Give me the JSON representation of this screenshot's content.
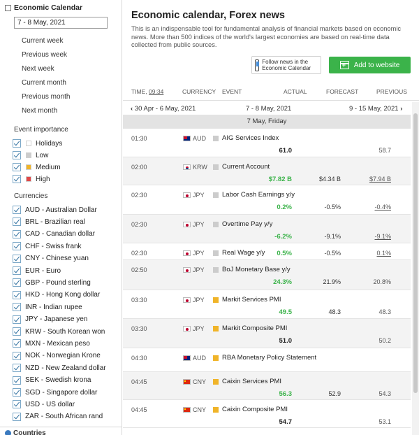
{
  "colors": {
    "accent_green": "#3bb34a",
    "actual_green": "#3bb34a",
    "actual_red": "#e0443a",
    "holidays": "#ffffff",
    "low": "#cccccc",
    "medium": "#f0b429",
    "high": "#e04848"
  },
  "sidebar": {
    "title": "Economic Calendar",
    "date_value": "7 - 8 May, 2021",
    "periods": [
      "Current week",
      "Previous week",
      "Next week",
      "Current month",
      "Previous month",
      "Next month"
    ],
    "importance_label": "Event importance",
    "importance": [
      {
        "label": "Holidays",
        "color": "#ffffff"
      },
      {
        "label": "Low",
        "color": "#cccccc"
      },
      {
        "label": "Medium",
        "color": "#f0b429"
      },
      {
        "label": "High",
        "color": "#e04848"
      }
    ],
    "currencies_label": "Currencies",
    "currencies": [
      "AUD - Australian Dollar",
      "BRL - Brazilian real",
      "CAD - Canadian dollar",
      "CHF - Swiss frank",
      "CNY - Chinese yuan",
      "EUR - Euro",
      "GBP - Pound sterling",
      "HKD - Hong Kong dollar",
      "INR - Indian rupee",
      "JPY - Japanese yen",
      "KRW - South Korean won",
      "MXN - Mexican peso",
      "NOK - Norwegian Krone",
      "NZD - New Zealand dollar",
      "SEK - Swedish krona",
      "SGD - Singapore dollar",
      "USD - US dollar",
      "ZAR - South African rand"
    ],
    "countries_label": "Countries"
  },
  "main": {
    "title": "Economic calendar, Forex news",
    "description": "This is an indispensable tool for fundamental analysis of financial markets based on economic news. More than 500 indices of the world's largest economies are based on real-time data collected from public sources.",
    "follow_label": "Follow news in the Economic Calendar",
    "add_label": "Add to website",
    "columns": {
      "time": "TIME,",
      "time_value": "09:34",
      "currency": "CURRENCY",
      "event": "EVENT",
      "actual": "ACTUAL",
      "forecast": "FORECAST",
      "previous": "PREVIOUS"
    },
    "nav": {
      "prev": "30 Apr - 6 May, 2021",
      "current": "7 - 8 May, 2021",
      "next": "9 - 15 May, 2021"
    },
    "day": "7 May, Friday",
    "events": [
      {
        "time": "01:30",
        "flag": "au",
        "currency": "AUD",
        "importance": "#cccccc",
        "event": "AIG Services Index",
        "actual": "61.0",
        "actual_color": "#222222",
        "forecast": "",
        "previous": "58.7",
        "prev_underline": false,
        "h": 41
      },
      {
        "time": "02:00",
        "flag": "kr",
        "currency": "KRW",
        "importance": "#cccccc",
        "event": "Current Account",
        "actual": "$7.82 B",
        "actual_color": "#3bb34a",
        "forecast": "$4.34 B",
        "previous": "$7.94 B",
        "prev_underline": true,
        "h": 40
      },
      {
        "time": "02:30",
        "flag": "jp",
        "currency": "JPY",
        "importance": "#cccccc",
        "event": "Labor Cash Earnings y/y",
        "actual": "0.2%",
        "actual_color": "#3bb34a",
        "forecast": "-0.5%",
        "previous": "-0.4%",
        "prev_underline": true,
        "h": 42
      },
      {
        "time": "02:30",
        "flag": "jp",
        "currency": "JPY",
        "importance": "#cccccc",
        "event": "Overtime Pay y/y",
        "actual": "-6.2%",
        "actual_color": "#3bb34a",
        "forecast": "-9.1%",
        "previous": "-9.1%",
        "prev_underline": true,
        "h": 41
      },
      {
        "time": "02:30",
        "flag": "jp",
        "currency": "JPY",
        "importance": "#cccccc",
        "event": "Real Wage y/y",
        "actual": "0.5%",
        "actual_color": "#3bb34a",
        "forecast": "-0.5%",
        "previous": "0.1%",
        "prev_underline": true,
        "h": 24
      },
      {
        "time": "02:50",
        "flag": "jp",
        "currency": "JPY",
        "importance": "#cccccc",
        "event": "BoJ Monetary Base y/y",
        "actual": "24.3%",
        "actual_color": "#3bb34a",
        "forecast": "21.9%",
        "previous": "20.8%",
        "prev_underline": false,
        "h": 43
      },
      {
        "time": "03:30",
        "flag": "jp",
        "currency": "JPY",
        "importance": "#f0b429",
        "event": "Markit Services PMI",
        "actual": "49.5",
        "actual_color": "#3bb34a",
        "forecast": "48.3",
        "previous": "48.3",
        "prev_underline": false,
        "h": 41
      },
      {
        "time": "03:30",
        "flag": "jp",
        "currency": "JPY",
        "importance": "#f0b429",
        "event": "Markit Composite PMI",
        "actual": "51.0",
        "actual_color": "#222222",
        "forecast": "",
        "previous": "50.2",
        "prev_underline": false,
        "h": 42
      },
      {
        "time": "04:30",
        "flag": "au",
        "currency": "AUD",
        "importance": "#f0b429",
        "event": "RBA Monetary Policy Statement",
        "actual": "",
        "actual_color": "#222222",
        "forecast": "",
        "previous": "",
        "prev_underline": false,
        "h": 34
      },
      {
        "time": "04:45",
        "flag": "cn",
        "currency": "CNY",
        "importance": "#f0b429",
        "event": "Caixin Services PMI",
        "actual": "56.3",
        "actual_color": "#3bb34a",
        "forecast": "52.9",
        "previous": "54.3",
        "prev_underline": false,
        "h": 40
      },
      {
        "time": "04:45",
        "flag": "cn",
        "currency": "CNY",
        "importance": "#f0b429",
        "event": "Caixin Composite PMI",
        "actual": "54.7",
        "actual_color": "#222222",
        "forecast": "",
        "previous": "53.1",
        "prev_underline": false,
        "h": 40
      }
    ]
  }
}
